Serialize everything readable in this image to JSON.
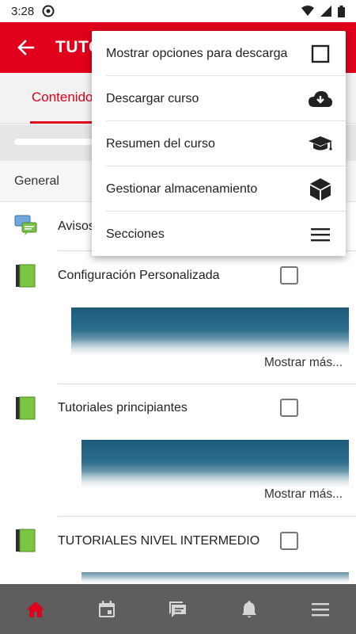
{
  "status_bar": {
    "time": "3:28"
  },
  "app_bar": {
    "title": "TUTORIALES"
  },
  "tabs": {
    "active_label": "Contenidos"
  },
  "section": {
    "title": "General"
  },
  "rows": [
    {
      "label": "Avisos"
    },
    {
      "label": "Configuración Personalizada"
    },
    {
      "label": "Tutoriales principiantes"
    },
    {
      "label": "TUTORIALES NIVEL INTERMEDIO"
    }
  ],
  "show_more": "Mostrar más...",
  "menu": {
    "items": [
      {
        "label": "Mostrar opciones para descarga",
        "icon": "checkbox-icon"
      },
      {
        "label": "Descargar curso",
        "icon": "cloud-download-icon"
      },
      {
        "label": "Resumen del curso",
        "icon": "graduation-cap-icon"
      },
      {
        "label": "Gestionar almacenamiento",
        "icon": "cube-icon"
      },
      {
        "label": "Secciones",
        "icon": "menu-lines-icon"
      }
    ]
  },
  "bottom_nav": {
    "items": [
      "home-icon",
      "calendar-icon",
      "messages-icon",
      "bell-icon",
      "menu-icon"
    ]
  },
  "colors": {
    "brand": "#e0001b",
    "nav_bg": "#5e5e5e"
  }
}
